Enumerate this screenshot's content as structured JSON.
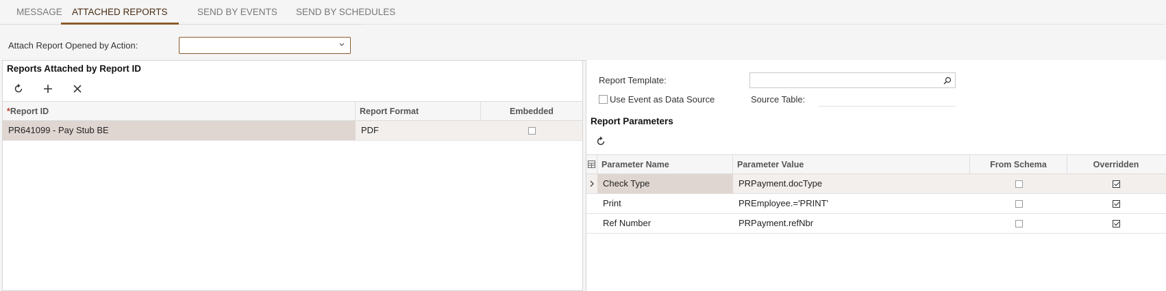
{
  "tabs": [
    {
      "label": "MESSAGE",
      "active": false
    },
    {
      "label": "ATTACHED REPORTS",
      "active": true
    },
    {
      "label": "SEND BY EVENTS",
      "active": false
    },
    {
      "label": "SEND BY SCHEDULES",
      "active": false
    }
  ],
  "attach_action": {
    "label": "Attach Report Opened by Action:",
    "value": ""
  },
  "left_panel": {
    "title": "Reports Attached by Report ID",
    "toolbar": {
      "refresh": "refresh-icon",
      "add": "plus-icon",
      "delete": "close-icon"
    },
    "columns": [
      "Report ID",
      "Report Format",
      "Embedded"
    ],
    "required_marker": "*",
    "rows": [
      {
        "report_id": "PR641099 - Pay Stub BE",
        "format": "PDF",
        "embedded": false
      }
    ]
  },
  "right_panel": {
    "report_template_label": "Report Template:",
    "report_template_value": "",
    "use_event_label": "Use Event as Data Source",
    "use_event_checked": false,
    "source_table_label": "Source Table:",
    "source_table_value": "",
    "params_title": "Report Parameters",
    "columns": [
      "Parameter Name",
      "Parameter Value",
      "From Schema",
      "Overridden"
    ],
    "rows": [
      {
        "name": "Check Type",
        "value": "PRPayment.docType",
        "from_schema": false,
        "overridden": true
      },
      {
        "name": "Print",
        "value": "PREmployee.='PRINT'",
        "from_schema": false,
        "overridden": true
      },
      {
        "name": "Ref Number",
        "value": "PRPayment.refNbr",
        "from_schema": false,
        "overridden": true
      }
    ]
  },
  "colors": {
    "accent": "#8b5a2b",
    "selected_row": "#e0d6d1",
    "alt_row": "#f2efed"
  }
}
